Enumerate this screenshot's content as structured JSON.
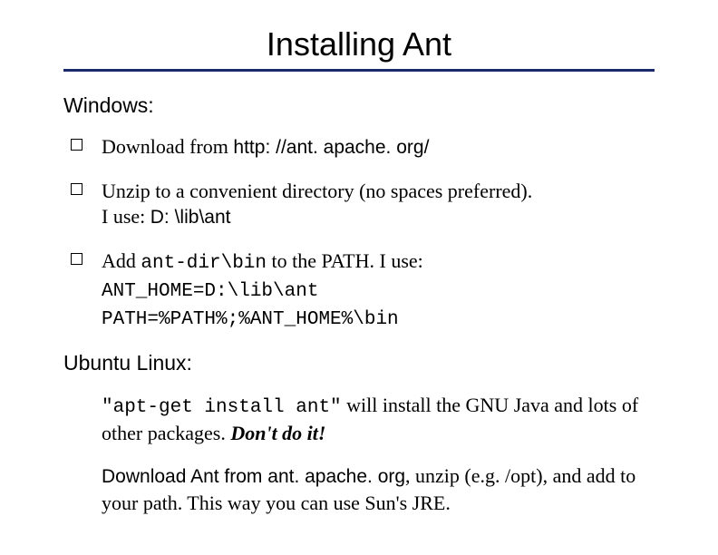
{
  "title": "Installing Ant",
  "windows": {
    "heading": "Windows:",
    "b1_pre": "Download from ",
    "b1_url": "http: //ant. apache. org/",
    "b2_line1": "Unzip to a convenient directory (no spaces preferred).",
    "b2_line2_pre": "I use:  ",
    "b2_line2_code": "D: \\lib\\ant",
    "b3_line1_pre": "Add ",
    "b3_line1_code": "ant-dir\\bin",
    "b3_line1_post": " to the PATH.  I use:",
    "b3_code1": "ANT_HOME=D:\\lib\\ant",
    "b3_code2": "PATH=%PATH%;%ANT_HOME%\\bin"
  },
  "ubuntu": {
    "heading": "Ubuntu Linux:",
    "p1_code": "\"apt-get install ant\"",
    "p1_rest": " will install the GNU Java and lots of other packages.  ",
    "p1_warn": "Don't do it!",
    "p2_pre": "Download Ant from ",
    "p2_host": "ant. apache. org",
    "p2_rest": ", unzip (e.g. /opt), and add to your path.  This way you can use Sun's JRE."
  }
}
